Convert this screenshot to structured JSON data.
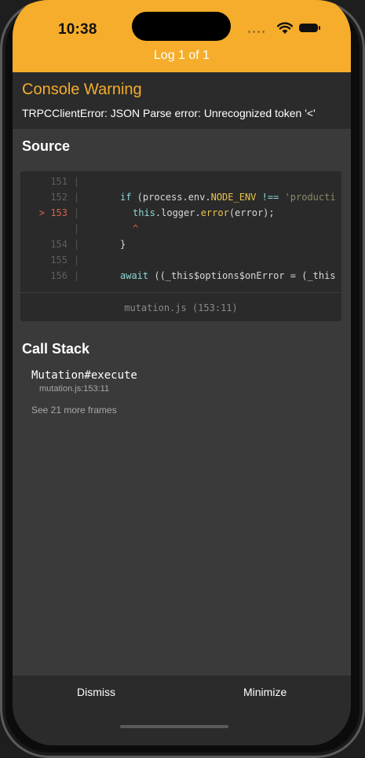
{
  "status_bar": {
    "time": "10:38"
  },
  "header": {
    "title": "Log 1 of 1"
  },
  "warning": {
    "title": "Console Warning",
    "message": "TRPCClientError: JSON Parse error: Unrecognized token '<'"
  },
  "source": {
    "title": "Source",
    "lines": [
      {
        "number": "151",
        "code": ""
      },
      {
        "number": "152",
        "code": "if (process.env.NODE_ENV !== 'producti"
      },
      {
        "number": "153",
        "code": "this.logger.error(error);"
      },
      {
        "number": "",
        "code": "^"
      },
      {
        "number": "154",
        "code": "}"
      },
      {
        "number": "155",
        "code": ""
      },
      {
        "number": "156",
        "code": "await ((_this$options$onError = (_this"
      }
    ],
    "active_marker": ">",
    "file_location": "mutation.js (153:11)"
  },
  "call_stack": {
    "title": "Call Stack",
    "frames": [
      {
        "name": "Mutation#execute",
        "location": "mutation.js:153:11"
      }
    ],
    "more_label": "See 21 more frames"
  },
  "actions": {
    "dismiss": "Dismiss",
    "minimize": "Minimize"
  },
  "colors": {
    "accent": "#f5ad2b",
    "error_marker": "#d8614d",
    "background": "#3a3a3a"
  }
}
